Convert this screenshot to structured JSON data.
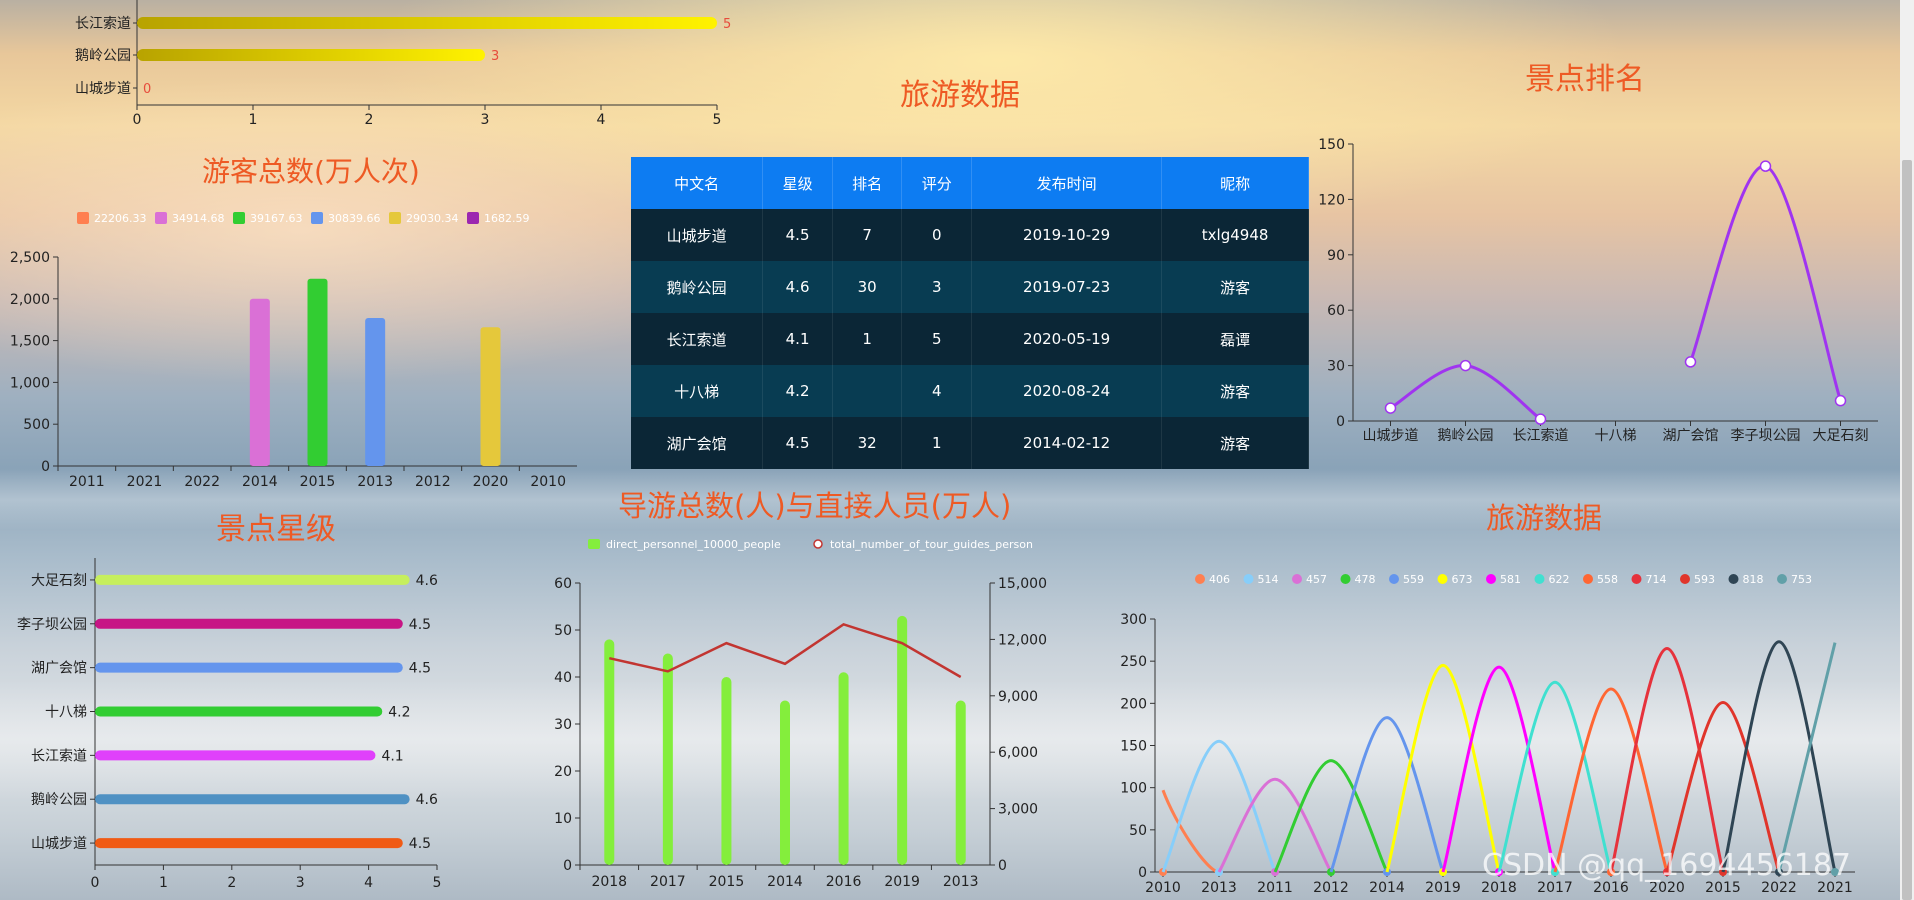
{
  "header": {
    "main_title": "旅游数据"
  },
  "charts": {
    "top_bar": {
      "chart_data": {
        "type": "bar",
        "categories": [
          "长江索道",
          "鹅岭公园",
          "山城步道"
        ],
        "values": [
          5,
          3,
          0
        ],
        "ticks": [
          "0",
          "1",
          "2",
          "3",
          "4",
          "5"
        ],
        "xlim": [
          0,
          5
        ]
      }
    },
    "visitors": {
      "title": "游客总数(万人次)",
      "chart_data": {
        "type": "bar",
        "categories": [
          "2011",
          "2021",
          "2022",
          "2014",
          "2015",
          "2013",
          "2012",
          "2020",
          "2010"
        ],
        "values": [
          0,
          0,
          0,
          2000,
          2240,
          1770,
          0,
          1660,
          0
        ],
        "ylim": [
          0,
          2500
        ],
        "yticks": [
          "0",
          "500",
          "1,000",
          "1,500",
          "2,000",
          "2,500"
        ],
        "legend": [
          "22206.33",
          "34914.68",
          "39167.63",
          "30839.66",
          "29030.34",
          "1682.59"
        ],
        "legend_colors": [
          "#ff7f50",
          "#da70d6",
          "#32cd32",
          "#6495ed",
          "#e5c83b",
          "#9c27b0"
        ]
      }
    },
    "ranking": {
      "title": "景点排名",
      "chart_data": {
        "type": "line",
        "categories": [
          "山城步道",
          "鹅岭公园",
          "长江索道",
          "十八梯",
          "湖广会馆",
          "李子坝公园",
          "大足石刻"
        ],
        "values": [
          7,
          30,
          1,
          null,
          32,
          138,
          11
        ],
        "ylim": [
          0,
          150
        ],
        "yticks": [
          "0",
          "30",
          "60",
          "90",
          "120",
          "150"
        ]
      }
    },
    "stars": {
      "title": "景点星级",
      "chart_data": {
        "type": "bar",
        "categories": [
          "大足石刻",
          "李子坝公园",
          "湖广会馆",
          "十八梯",
          "长江索道",
          "鹅岭公园",
          "山城步道"
        ],
        "values": [
          4.6,
          4.5,
          4.5,
          4.2,
          4.1,
          4.6,
          4.5
        ],
        "labels": [
          "4.6",
          "4.5",
          "4.5",
          "4.2",
          "4.1",
          "4.6",
          "4.5"
        ],
        "colors": [
          "#c6ef5d",
          "#c71585",
          "#6495ed",
          "#32cd32",
          "#e040fb",
          "#4f91c3",
          "#f05a14"
        ],
        "xlim": [
          0,
          5
        ],
        "xticks": [
          "0",
          "1",
          "2",
          "3",
          "4",
          "5"
        ]
      }
    },
    "guides": {
      "title": "导游总数(人)与直接人员(万人)",
      "chart_data": {
        "type": "bar",
        "categories": [
          "2018",
          "2017",
          "2015",
          "2014",
          "2016",
          "2019",
          "2013"
        ],
        "series": [
          {
            "name": "direct_personnel_10000_people",
            "type": "bar",
            "values": [
              48,
              45,
              40,
              35,
              41,
              53,
              35
            ]
          },
          {
            "name": "total_number_of_tour_guides_person",
            "type": "line",
            "values": [
              11000,
              10300,
              11800,
              10700,
              12800,
              11800,
              10000
            ]
          }
        ],
        "ylim_left": [
          0,
          60
        ],
        "ylim_right": [
          0,
          15000
        ],
        "yticks_left": [
          "0",
          "10",
          "20",
          "30",
          "40",
          "50",
          "60"
        ],
        "yticks_right": [
          "0",
          "3,000",
          "6,000",
          "9,000",
          "12,000",
          "15,000"
        ]
      }
    },
    "tourism": {
      "title": "旅游数据",
      "chart_data": {
        "type": "line",
        "categories": [
          "2010",
          "2013",
          "2011",
          "2012",
          "2014",
          "2019",
          "2018",
          "2017",
          "2016",
          "2020",
          "2015",
          "2022",
          "2021"
        ],
        "legend": [
          "406",
          "514",
          "457",
          "478",
          "559",
          "673",
          "581",
          "622",
          "558",
          "714",
          "593",
          "818",
          "753"
        ],
        "peaks": [
          97,
          155,
          110,
          132,
          183,
          245,
          243,
          225,
          217,
          265,
          201,
          273,
          272
        ],
        "colors": [
          "#ff7f50",
          "#87cefa",
          "#da70d6",
          "#32cd32",
          "#6495ed",
          "#ffff00",
          "#ff00ff",
          "#40e0d0",
          "#ff6633",
          "#e6323c",
          "#e0352b",
          "#2f4554",
          "#61a0a8"
        ],
        "ylim": [
          0,
          300
        ],
        "yticks": [
          "0",
          "50",
          "100",
          "150",
          "200",
          "250",
          "300"
        ]
      }
    }
  },
  "table": {
    "headers": [
      "中文名",
      "星级",
      "排名",
      "评分",
      "发布时间",
      "昵称"
    ],
    "rows": [
      [
        "山城步道",
        "4.5",
        "7",
        "0",
        "2019-10-29",
        "txlg4948"
      ],
      [
        "鹅岭公园",
        "4.6",
        "30",
        "3",
        "2019-07-23",
        "游客"
      ],
      [
        "长江索道",
        "4.1",
        "1",
        "5",
        "2020-05-19",
        "磊谭"
      ],
      [
        "十八梯",
        "4.2",
        "",
        "4",
        "2020-08-24",
        "游客"
      ],
      [
        "湖广会馆",
        "4.5",
        "32",
        "1",
        "2014-02-12",
        "游客"
      ]
    ]
  },
  "watermark": "CSDN @qq_1694456187"
}
